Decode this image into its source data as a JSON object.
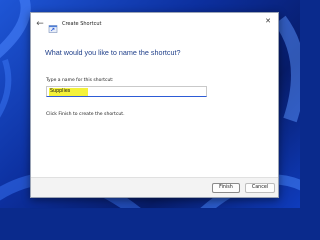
{
  "dialog": {
    "title": "Create Shortcut",
    "back_glyph": "←",
    "close_glyph": "✕",
    "heading": "What would you like to name the shortcut?",
    "field_label": "Type a name for this shortcut:",
    "name_value": "Supplies",
    "hint": "Click Finish to create the shortcut.",
    "finish_label": "Finish",
    "cancel_label": "Cancel"
  },
  "icons": {
    "back": "back-arrow-icon",
    "title": "shortcut-icon",
    "close": "close-icon"
  },
  "colors": {
    "heading": "#1f3f8a",
    "input_underline": "#2d5bd6",
    "highlight": "#f5f23b",
    "wallpaper": "#0c2f9e"
  }
}
